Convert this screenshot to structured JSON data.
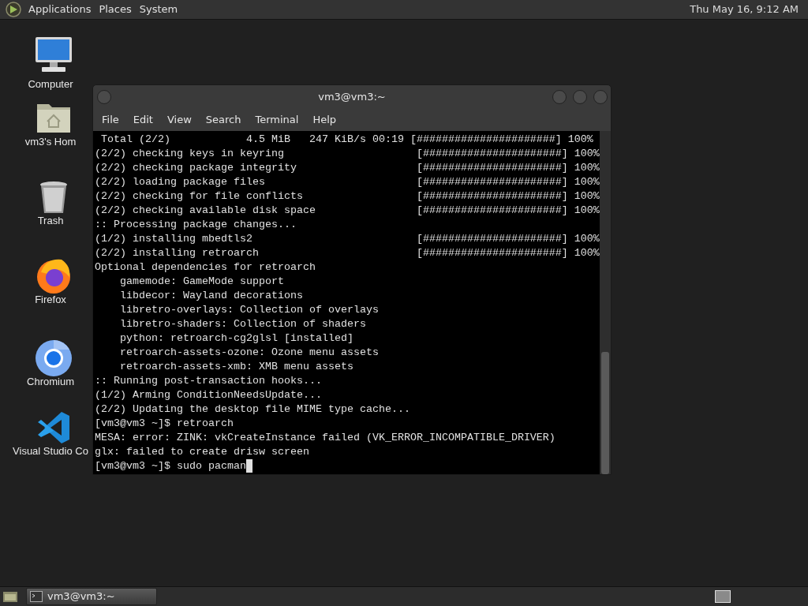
{
  "top_panel": {
    "menus": [
      "Applications",
      "Places",
      "System"
    ],
    "clock": "Thu May 16,  9:12 AM"
  },
  "desktop_icons": [
    {
      "kind": "computer",
      "label": "Computer"
    },
    {
      "kind": "home",
      "label": "vm3's Hom"
    },
    {
      "kind": "trash",
      "label": "Trash"
    },
    {
      "kind": "firefox",
      "label": "Firefox"
    },
    {
      "kind": "chromium",
      "label": "Chromium"
    },
    {
      "kind": "vscode",
      "label": "Visual Studio Co"
    }
  ],
  "terminal": {
    "title": "vm3@vm3:~",
    "menu": [
      "File",
      "Edit",
      "View",
      "Search",
      "Terminal",
      "Help"
    ],
    "lines": [
      " Total (2/2)            4.5 MiB   247 KiB/s 00:19 [######################] 100%",
      "(2/2) checking keys in keyring                     [######################] 100%",
      "(2/2) checking package integrity                   [######################] 100%",
      "(2/2) loading package files                        [######################] 100%",
      "(2/2) checking for file conflicts                  [######################] 100%",
      "(2/2) checking available disk space                [######################] 100%",
      ":: Processing package changes...",
      "(1/2) installing mbedtls2                          [######################] 100%",
      "(2/2) installing retroarch                         [######################] 100%",
      "Optional dependencies for retroarch",
      "    gamemode: GameMode support",
      "    libdecor: Wayland decorations",
      "    libretro-overlays: Collection of overlays",
      "    libretro-shaders: Collection of shaders",
      "    python: retroarch-cg2glsl [installed]",
      "    retroarch-assets-ozone: Ozone menu assets",
      "    retroarch-assets-xmb: XMB menu assets",
      ":: Running post-transaction hooks...",
      "(1/2) Arming ConditionNeedsUpdate...",
      "(2/2) Updating the desktop file MIME type cache...",
      "[vm3@vm3 ~]$ retroarch",
      "MESA: error: ZINK: vkCreateInstance failed (VK_ERROR_INCOMPATIBLE_DRIVER)",
      "glx: failed to create drisw screen",
      "[vm3@vm3 ~]$ sudo pacman"
    ]
  },
  "taskbar": {
    "tasks": [
      "vm3@vm3:~"
    ]
  }
}
